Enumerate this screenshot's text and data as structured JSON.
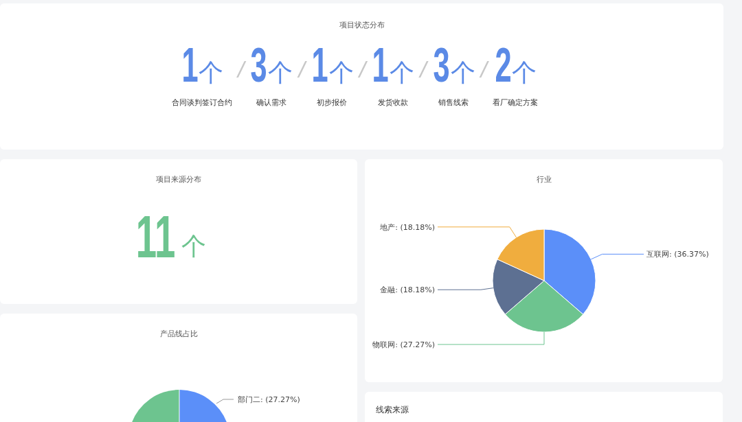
{
  "status_panel": {
    "title": "项目状态分布",
    "items": [
      {
        "count": "1",
        "unit": "个",
        "label": "合同谈判签订合约"
      },
      {
        "count": "3",
        "unit": "个",
        "label": "确认需求"
      },
      {
        "count": "1",
        "unit": "个",
        "label": "初步报价"
      },
      {
        "count": "1",
        "unit": "个",
        "label": "发货收款"
      },
      {
        "count": "3",
        "unit": "个",
        "label": "销售线索"
      },
      {
        "count": "2",
        "unit": "个",
        "label": "看厂确定方案"
      }
    ],
    "separators": [
      "/",
      "/",
      "/",
      "/",
      "/"
    ]
  },
  "source_panel": {
    "title": "项目来源分布",
    "count": "11",
    "unit": "个"
  },
  "industry_panel": {
    "title": "行业",
    "chart_data": {
      "type": "pie",
      "values": [
        36.37,
        27.27,
        18.18,
        18.18
      ],
      "colors": [
        "#5b8ff9",
        "#6dc48f",
        "#5d7092",
        "#f0ad3e"
      ],
      "data_labels": true,
      "value_labels": [
        "互联网: (36.37%)",
        "物联网: (27.27%)",
        "金融: (18.18%)",
        "地产: (18.18%)"
      ]
    }
  },
  "product_panel": {
    "title": "产品线占比",
    "slice_label": "部门二: (27.27%)"
  },
  "clue_panel": {
    "title": "线索来源"
  }
}
